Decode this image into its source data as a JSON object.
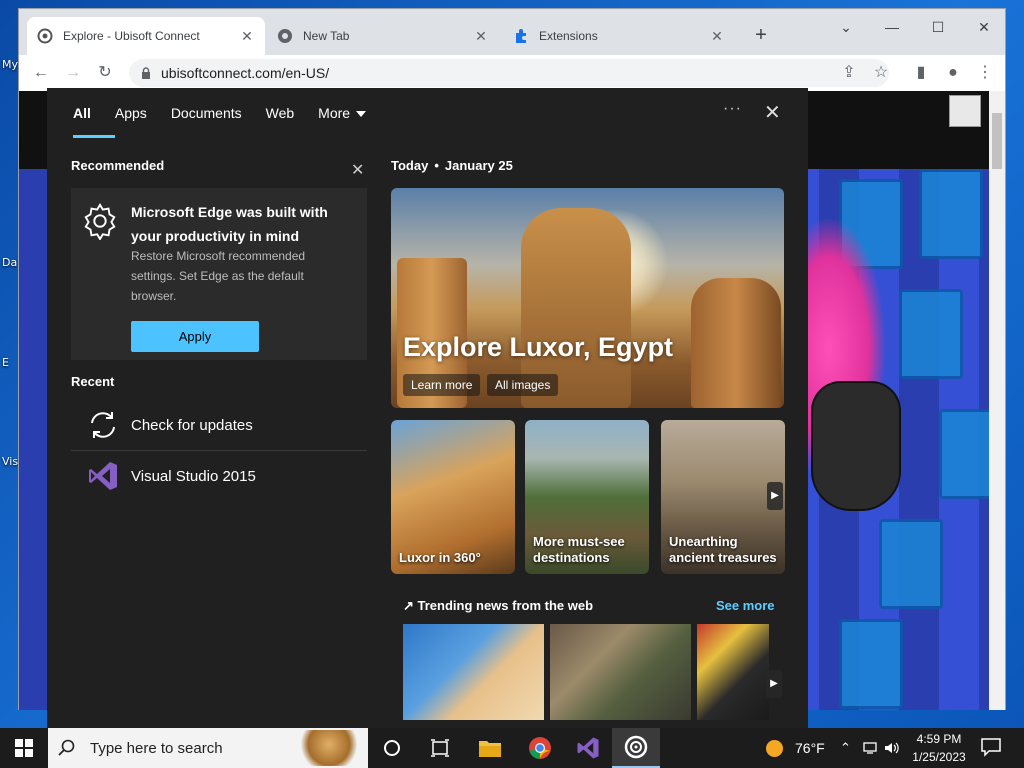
{
  "browser": {
    "tabs": [
      {
        "label": "Explore - Ubisoft Connect",
        "close": "✕"
      },
      {
        "label": "New Tab",
        "close": "✕"
      },
      {
        "label": "Extensions",
        "close": "✕"
      }
    ],
    "new_tab": "+",
    "url": "ubisoftconnect.com/en-US/"
  },
  "search_panel": {
    "tabs": [
      "All",
      "Apps",
      "Documents",
      "Web",
      "More"
    ],
    "dots": "···",
    "close": "✕",
    "recommended": {
      "heading": "Recommended",
      "title": "Microsoft Edge was built with your productivity in mind",
      "description": "Restore Microsoft recommended settings. Set Edge as the default browser.",
      "button": "Apply"
    },
    "recent": {
      "heading": "Recent",
      "items": [
        {
          "label": "Check for updates",
          "icon": "refresh-icon"
        },
        {
          "label": "Visual Studio 2015",
          "icon": "visual-studio-icon"
        }
      ]
    },
    "today": {
      "label": "Today",
      "separator": "•",
      "date": "January 25"
    },
    "hero": {
      "title": "Explore Luxor, Egypt",
      "learn_more": "Learn more",
      "all_images": "All images"
    },
    "cards": [
      {
        "label": "Luxor in 360°"
      },
      {
        "label": "More must-see destinations"
      },
      {
        "label": "Unearthing ancient treasures"
      }
    ],
    "trending": {
      "heading": "Trending news from the web",
      "see_more": "See more"
    }
  },
  "taskbar": {
    "search_placeholder": "Type here to search",
    "weather": "76°F",
    "time": "4:59 PM",
    "date": "1/25/2023"
  },
  "colors": {
    "accent": "#4cc2ff",
    "link": "#60cdff",
    "panel_bg": "#202020"
  }
}
